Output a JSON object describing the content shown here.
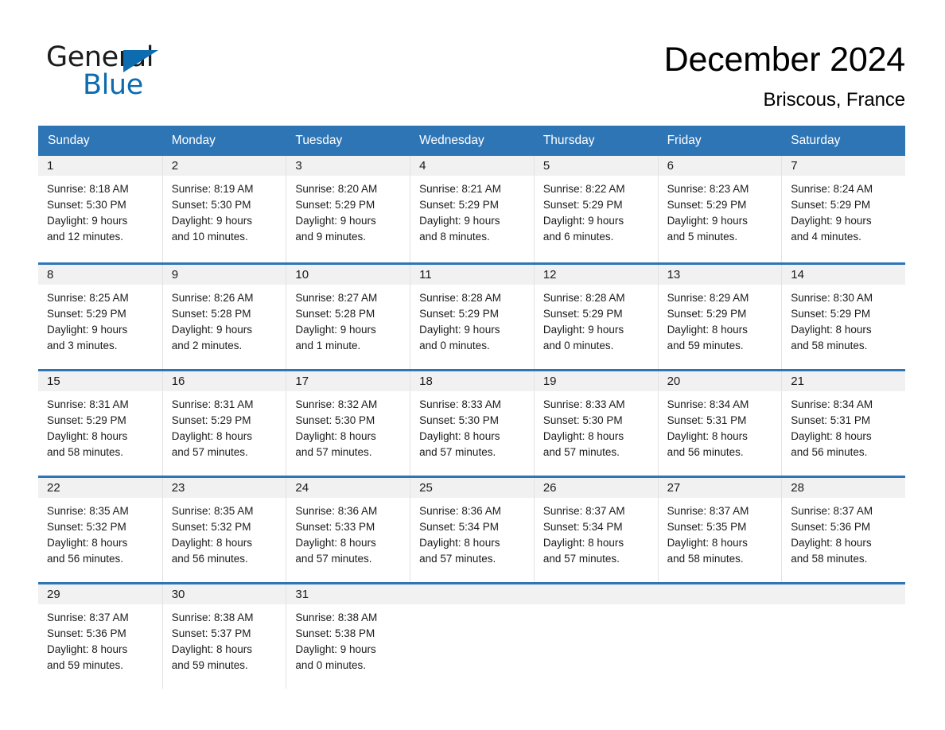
{
  "brand": {
    "word_one": "General",
    "word_two": "Blue",
    "triangle_icon": "triangle-icon",
    "accent_color": "#0d6bb0"
  },
  "header": {
    "title": "December 2024",
    "location": "Briscous, France"
  },
  "theme": {
    "header_blue": "#2e75b6",
    "daynum_band": "#f1f1f1",
    "cell_divider": "#e2e2e2",
    "text": "#1b1b1b"
  },
  "calendar": {
    "weekdays": [
      "Sunday",
      "Monday",
      "Tuesday",
      "Wednesday",
      "Thursday",
      "Friday",
      "Saturday"
    ],
    "weeks": [
      [
        {
          "day": "1",
          "sunrise": "Sunrise: 8:18 AM",
          "sunset": "Sunset: 5:30 PM",
          "daylight_1": "Daylight: 9 hours",
          "daylight_2": "and 12 minutes."
        },
        {
          "day": "2",
          "sunrise": "Sunrise: 8:19 AM",
          "sunset": "Sunset: 5:30 PM",
          "daylight_1": "Daylight: 9 hours",
          "daylight_2": "and 10 minutes."
        },
        {
          "day": "3",
          "sunrise": "Sunrise: 8:20 AM",
          "sunset": "Sunset: 5:29 PM",
          "daylight_1": "Daylight: 9 hours",
          "daylight_2": "and 9 minutes."
        },
        {
          "day": "4",
          "sunrise": "Sunrise: 8:21 AM",
          "sunset": "Sunset: 5:29 PM",
          "daylight_1": "Daylight: 9 hours",
          "daylight_2": "and 8 minutes."
        },
        {
          "day": "5",
          "sunrise": "Sunrise: 8:22 AM",
          "sunset": "Sunset: 5:29 PM",
          "daylight_1": "Daylight: 9 hours",
          "daylight_2": "and 6 minutes."
        },
        {
          "day": "6",
          "sunrise": "Sunrise: 8:23 AM",
          "sunset": "Sunset: 5:29 PM",
          "daylight_1": "Daylight: 9 hours",
          "daylight_2": "and 5 minutes."
        },
        {
          "day": "7",
          "sunrise": "Sunrise: 8:24 AM",
          "sunset": "Sunset: 5:29 PM",
          "daylight_1": "Daylight: 9 hours",
          "daylight_2": "and 4 minutes."
        }
      ],
      [
        {
          "day": "8",
          "sunrise": "Sunrise: 8:25 AM",
          "sunset": "Sunset: 5:29 PM",
          "daylight_1": "Daylight: 9 hours",
          "daylight_2": "and 3 minutes."
        },
        {
          "day": "9",
          "sunrise": "Sunrise: 8:26 AM",
          "sunset": "Sunset: 5:28 PM",
          "daylight_1": "Daylight: 9 hours",
          "daylight_2": "and 2 minutes."
        },
        {
          "day": "10",
          "sunrise": "Sunrise: 8:27 AM",
          "sunset": "Sunset: 5:28 PM",
          "daylight_1": "Daylight: 9 hours",
          "daylight_2": "and 1 minute."
        },
        {
          "day": "11",
          "sunrise": "Sunrise: 8:28 AM",
          "sunset": "Sunset: 5:29 PM",
          "daylight_1": "Daylight: 9 hours",
          "daylight_2": "and 0 minutes."
        },
        {
          "day": "12",
          "sunrise": "Sunrise: 8:28 AM",
          "sunset": "Sunset: 5:29 PM",
          "daylight_1": "Daylight: 9 hours",
          "daylight_2": "and 0 minutes."
        },
        {
          "day": "13",
          "sunrise": "Sunrise: 8:29 AM",
          "sunset": "Sunset: 5:29 PM",
          "daylight_1": "Daylight: 8 hours",
          "daylight_2": "and 59 minutes."
        },
        {
          "day": "14",
          "sunrise": "Sunrise: 8:30 AM",
          "sunset": "Sunset: 5:29 PM",
          "daylight_1": "Daylight: 8 hours",
          "daylight_2": "and 58 minutes."
        }
      ],
      [
        {
          "day": "15",
          "sunrise": "Sunrise: 8:31 AM",
          "sunset": "Sunset: 5:29 PM",
          "daylight_1": "Daylight: 8 hours",
          "daylight_2": "and 58 minutes."
        },
        {
          "day": "16",
          "sunrise": "Sunrise: 8:31 AM",
          "sunset": "Sunset: 5:29 PM",
          "daylight_1": "Daylight: 8 hours",
          "daylight_2": "and 57 minutes."
        },
        {
          "day": "17",
          "sunrise": "Sunrise: 8:32 AM",
          "sunset": "Sunset: 5:30 PM",
          "daylight_1": "Daylight: 8 hours",
          "daylight_2": "and 57 minutes."
        },
        {
          "day": "18",
          "sunrise": "Sunrise: 8:33 AM",
          "sunset": "Sunset: 5:30 PM",
          "daylight_1": "Daylight: 8 hours",
          "daylight_2": "and 57 minutes."
        },
        {
          "day": "19",
          "sunrise": "Sunrise: 8:33 AM",
          "sunset": "Sunset: 5:30 PM",
          "daylight_1": "Daylight: 8 hours",
          "daylight_2": "and 57 minutes."
        },
        {
          "day": "20",
          "sunrise": "Sunrise: 8:34 AM",
          "sunset": "Sunset: 5:31 PM",
          "daylight_1": "Daylight: 8 hours",
          "daylight_2": "and 56 minutes."
        },
        {
          "day": "21",
          "sunrise": "Sunrise: 8:34 AM",
          "sunset": "Sunset: 5:31 PM",
          "daylight_1": "Daylight: 8 hours",
          "daylight_2": "and 56 minutes."
        }
      ],
      [
        {
          "day": "22",
          "sunrise": "Sunrise: 8:35 AM",
          "sunset": "Sunset: 5:32 PM",
          "daylight_1": "Daylight: 8 hours",
          "daylight_2": "and 56 minutes."
        },
        {
          "day": "23",
          "sunrise": "Sunrise: 8:35 AM",
          "sunset": "Sunset: 5:32 PM",
          "daylight_1": "Daylight: 8 hours",
          "daylight_2": "and 56 minutes."
        },
        {
          "day": "24",
          "sunrise": "Sunrise: 8:36 AM",
          "sunset": "Sunset: 5:33 PM",
          "daylight_1": "Daylight: 8 hours",
          "daylight_2": "and 57 minutes."
        },
        {
          "day": "25",
          "sunrise": "Sunrise: 8:36 AM",
          "sunset": "Sunset: 5:34 PM",
          "daylight_1": "Daylight: 8 hours",
          "daylight_2": "and 57 minutes."
        },
        {
          "day": "26",
          "sunrise": "Sunrise: 8:37 AM",
          "sunset": "Sunset: 5:34 PM",
          "daylight_1": "Daylight: 8 hours",
          "daylight_2": "and 57 minutes."
        },
        {
          "day": "27",
          "sunrise": "Sunrise: 8:37 AM",
          "sunset": "Sunset: 5:35 PM",
          "daylight_1": "Daylight: 8 hours",
          "daylight_2": "and 58 minutes."
        },
        {
          "day": "28",
          "sunrise": "Sunrise: 8:37 AM",
          "sunset": "Sunset: 5:36 PM",
          "daylight_1": "Daylight: 8 hours",
          "daylight_2": "and 58 minutes."
        }
      ],
      [
        {
          "day": "29",
          "sunrise": "Sunrise: 8:37 AM",
          "sunset": "Sunset: 5:36 PM",
          "daylight_1": "Daylight: 8 hours",
          "daylight_2": "and 59 minutes."
        },
        {
          "day": "30",
          "sunrise": "Sunrise: 8:38 AM",
          "sunset": "Sunset: 5:37 PM",
          "daylight_1": "Daylight: 8 hours",
          "daylight_2": "and 59 minutes."
        },
        {
          "day": "31",
          "sunrise": "Sunrise: 8:38 AM",
          "sunset": "Sunset: 5:38 PM",
          "daylight_1": "Daylight: 9 hours",
          "daylight_2": "and 0 minutes."
        },
        {
          "day": "",
          "sunrise": "",
          "sunset": "",
          "daylight_1": "",
          "daylight_2": ""
        },
        {
          "day": "",
          "sunrise": "",
          "sunset": "",
          "daylight_1": "",
          "daylight_2": ""
        },
        {
          "day": "",
          "sunrise": "",
          "sunset": "",
          "daylight_1": "",
          "daylight_2": ""
        },
        {
          "day": "",
          "sunrise": "",
          "sunset": "",
          "daylight_1": "",
          "daylight_2": ""
        }
      ]
    ]
  }
}
